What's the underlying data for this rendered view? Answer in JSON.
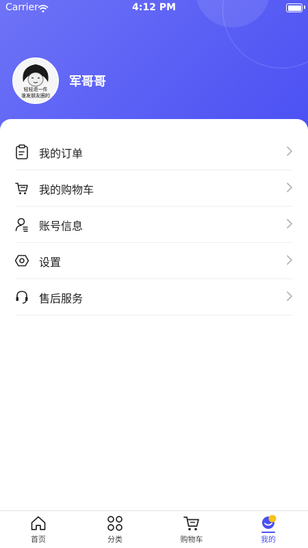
{
  "status_bar": {
    "carrier": "Carrier",
    "time": "4:12 PM"
  },
  "profile": {
    "username": "军哥哥",
    "avatar_caption_line1": "轻轻退一件",
    "avatar_caption_line2": "谁发朋友圈的"
  },
  "menu": {
    "items": [
      {
        "label": "我的订单",
        "icon": "clipboard-icon"
      },
      {
        "label": "我的购物车",
        "icon": "cart-icon"
      },
      {
        "label": "账号信息",
        "icon": "user-info-icon"
      },
      {
        "label": "设置",
        "icon": "settings-icon"
      },
      {
        "label": "售后服务",
        "icon": "headset-icon"
      }
    ]
  },
  "tabbar": {
    "tabs": [
      {
        "label": "首页",
        "icon": "home-icon"
      },
      {
        "label": "分类",
        "icon": "grid-icon"
      },
      {
        "label": "购物车",
        "icon": "cart-icon"
      },
      {
        "label": "我的",
        "icon": "moon-profile-icon",
        "active": true
      }
    ]
  },
  "colors": {
    "accent": "#4a50f2",
    "header_start": "#6e73f7",
    "header_end": "#4b50f3"
  }
}
